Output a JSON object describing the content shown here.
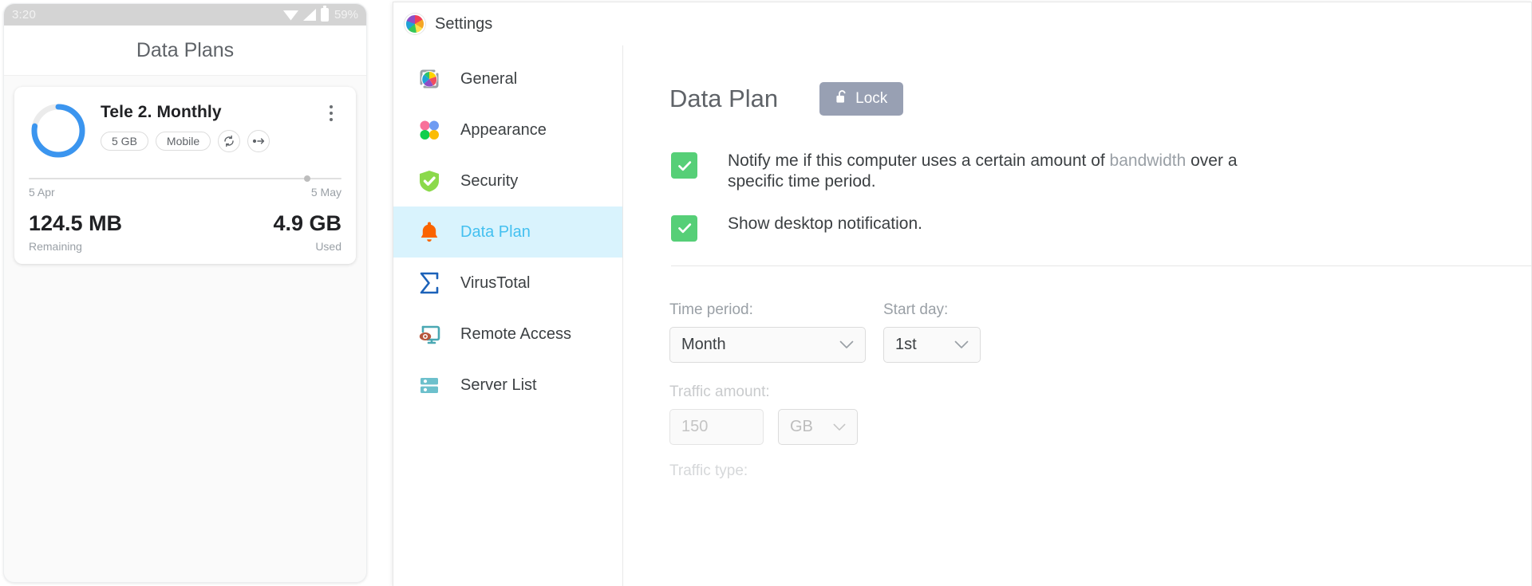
{
  "phone": {
    "status_bar": {
      "time": "3:20",
      "battery_percent": "59%",
      "icons": [
        "wifi-icon",
        "cellular-signal-icon",
        "battery-icon"
      ]
    },
    "app_title": "Data Plans",
    "plan_card": {
      "name": "Tele 2. Monthly",
      "chips": [
        {
          "label": "5 GB",
          "name": "quota-chip"
        },
        {
          "label": "Mobile",
          "name": "network-type-chip"
        }
      ],
      "icon_chips": [
        {
          "glyph": "↻",
          "name": "recurring-icon"
        },
        {
          "glyph": "•→",
          "name": "rollover-icon"
        }
      ],
      "kebab": "more-options-icon",
      "timeline": {
        "start": "5 Apr",
        "end": "5 May",
        "progress_percent": 88
      },
      "remaining_value": "124.5 MB",
      "remaining_label": "Remaining",
      "used_value": "4.9 GB",
      "used_label": "Used",
      "ring_percent": 78,
      "ring_color": "#3b95ef"
    }
  },
  "window": {
    "title": "Settings",
    "sidebar": [
      {
        "label": "General",
        "icon": "color-wheel-icon",
        "active": false
      },
      {
        "label": "Appearance",
        "icon": "four-dots-icon",
        "active": false
      },
      {
        "label": "Security",
        "icon": "shield-check-icon",
        "active": false
      },
      {
        "label": "Data Plan",
        "icon": "bell-icon",
        "active": true
      },
      {
        "label": "VirusTotal",
        "icon": "sigma-icon",
        "active": false
      },
      {
        "label": "Remote Access",
        "icon": "monitor-eye-icon",
        "active": false
      },
      {
        "label": "Server List",
        "icon": "server-rack-icon",
        "active": false
      }
    ],
    "content": {
      "page_title": "Data Plan",
      "lock_button": {
        "label": "Lock",
        "icon": "open-padlock-icon"
      },
      "checkboxes": [
        {
          "checked": true,
          "text_main": "Notify me if this computer uses a certain amount of ",
          "text_muted": "bandwidth",
          "text_rest": " over a specific time period."
        },
        {
          "checked": true,
          "text_main": "Show desktop notification.",
          "text_muted": "",
          "text_rest": ""
        }
      ],
      "fields": {
        "time_period_label": "Time period:",
        "time_period_value": "Month",
        "start_day_label": "Start day:",
        "start_day_value": "1st",
        "traffic_amount_label": "Traffic amount:",
        "traffic_amount_value": "150",
        "traffic_unit_value": "GB",
        "cut_off_label": "Traffic type:"
      },
      "accent_color": "#44c0f0",
      "checkbox_color": "#56cf77",
      "active_row_color": "#d9f3fd"
    }
  }
}
